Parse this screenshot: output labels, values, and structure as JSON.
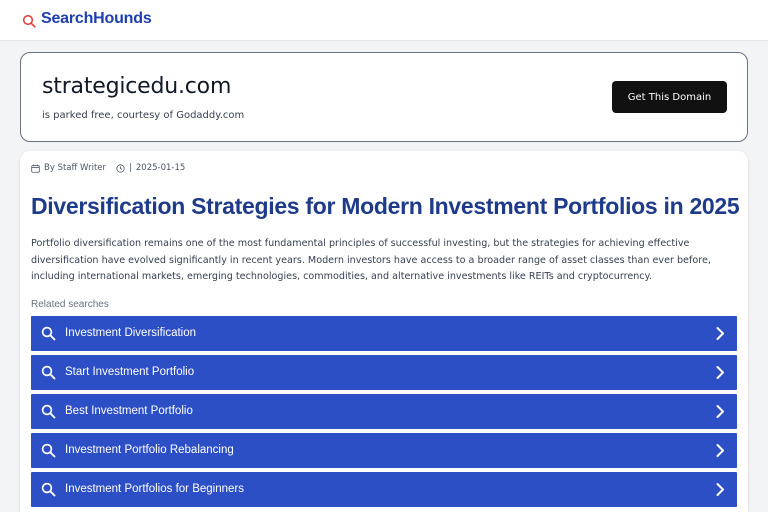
{
  "header": {
    "brand": "SearchHounds",
    "brand_icon": "search-icon",
    "accent": "#1e3fae"
  },
  "domain_card": {
    "domain": "strategicedu.com",
    "subtitle": "is parked free, courtesy of Godaddy.com",
    "cta_label": "Get This Domain"
  },
  "article": {
    "author": "By Staff Writer",
    "separator": "|",
    "date": "2025-01-15",
    "title": "Diversification Strategies for Modern Investment Portfolios in 2025",
    "intro_lines": [
      "Portfolio diversification remains one of the most fundamental principles of successful investing, but the strategies for achieving effective",
      "diversification have evolved significantly in recent years. Modern investors have access to a broader range of asset classes than ever before,",
      "including international markets, emerging technologies, commodities, and alternative investments like REITs and cryptocurrency."
    ]
  },
  "related": {
    "label": "Related searches",
    "item_color": "#2d4fc5",
    "items": [
      "Investment Diversification",
      "Start Investment Portfolio",
      "Best Investment Portfolio",
      "Investment Portfolio Rebalancing",
      "Investment Portfolios for Beginners"
    ]
  }
}
